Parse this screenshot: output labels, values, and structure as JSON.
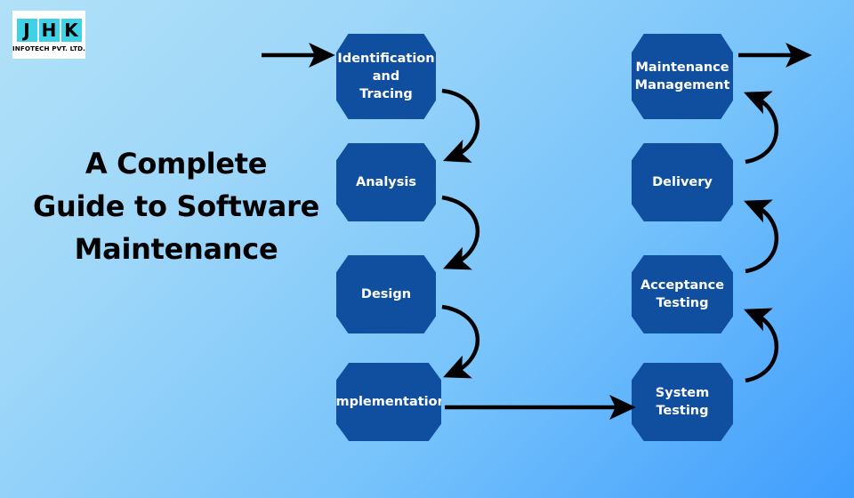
{
  "logo": {
    "letters": [
      "J",
      "H",
      "K"
    ],
    "subtitle": "INFOTECH PVT. LTD.",
    "letter_bg": "#3fd2e6",
    "box_bg": "#ffffff"
  },
  "title": {
    "line1": "A Complete",
    "line2": "Guide to Software",
    "line3": "Maintenance",
    "color": "#000000"
  },
  "colors": {
    "node_fill": "#104fa0",
    "node_text": "#ffffff",
    "arrow": "#000000",
    "bg_top_left": "#b1e1f7",
    "bg_bottom_right": "#3f9dfd"
  },
  "flow": {
    "left_column": [
      {
        "id": "identification-and-tracing",
        "label": "Identification and Tracing",
        "lines": [
          "Identification",
          "and",
          "Tracing"
        ]
      },
      {
        "id": "analysis",
        "label": "Analysis",
        "lines": [
          "Analysis"
        ]
      },
      {
        "id": "design",
        "label": "Design",
        "lines": [
          "Design"
        ]
      },
      {
        "id": "implementation",
        "label": "Implementation",
        "lines": [
          "Implementation"
        ]
      }
    ],
    "right_column": [
      {
        "id": "maintenance-management",
        "label": "Maintenance Management",
        "lines": [
          "Maintenance",
          "Management"
        ]
      },
      {
        "id": "delivery",
        "label": "Delivery",
        "lines": [
          "Delivery"
        ]
      },
      {
        "id": "acceptance-testing",
        "label": "Acceptance Testing",
        "lines": [
          "Acceptance",
          "Testing"
        ]
      },
      {
        "id": "system-testing",
        "label": "System Testing",
        "lines": [
          "System",
          "Testing"
        ]
      }
    ],
    "connectors": [
      {
        "id": "input-arrow",
        "kind": "straight",
        "direction": "right"
      },
      {
        "id": "identification-to-analysis",
        "kind": "curved",
        "direction": "down"
      },
      {
        "id": "analysis-to-design",
        "kind": "curved",
        "direction": "down"
      },
      {
        "id": "design-to-implementation",
        "kind": "curved",
        "direction": "down"
      },
      {
        "id": "implementation-to-system-testing",
        "kind": "straight",
        "direction": "right"
      },
      {
        "id": "system-testing-to-acceptance-testing",
        "kind": "curved",
        "direction": "up"
      },
      {
        "id": "acceptance-testing-to-delivery",
        "kind": "curved",
        "direction": "up"
      },
      {
        "id": "delivery-to-maintenance-management",
        "kind": "curved",
        "direction": "up"
      },
      {
        "id": "output-arrow",
        "kind": "straight",
        "direction": "right"
      }
    ]
  }
}
